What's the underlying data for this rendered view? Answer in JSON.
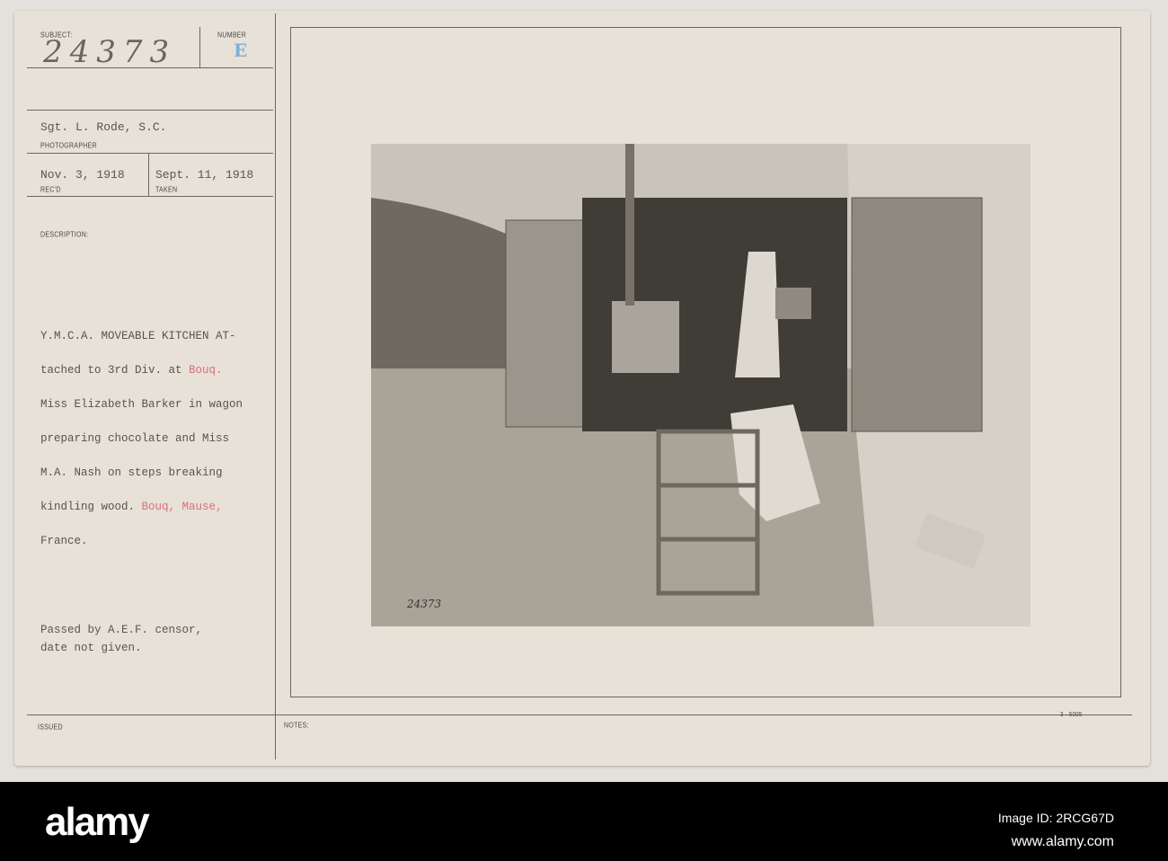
{
  "card": {
    "subject_label": "SUBJECT:",
    "subject_value": "24373",
    "number_label": "NUMBER",
    "number_value": "E",
    "photographer_name": "Sgt. L. Rode, S.C.",
    "photographer_label": "PHOTOGRAPHER",
    "received_date": "Nov. 3, 1918",
    "received_label": "REC'D",
    "taken_date": "Sept. 11, 1918",
    "taken_label": "TAKEN",
    "description_label": "DESCRIPTION:",
    "description_lines": [
      [
        "Y.M.C.A. MOVEABLE KITCHEN AT-",
        ""
      ],
      [
        "tached to 3rd Div. at ",
        "Bouq."
      ],
      [
        "Miss Elizabeth Barker in wagon",
        ""
      ],
      [
        "preparing chocolate and Miss",
        ""
      ],
      [
        "M.A. Nash on steps breaking",
        ""
      ],
      [
        "kindling wood. ",
        "Bouq, Mause,"
      ],
      [
        "France.",
        ""
      ]
    ],
    "censor_line1": "Passed by A.E.F. censor,",
    "censor_line2": "date not given.",
    "issued_label": "ISSUED",
    "notes_label": "NOTES:",
    "form_number": "3—5005",
    "photo_stamp_number": "24373"
  },
  "footer": {
    "logo": "alamy",
    "image_id": "Image ID: 2RCG67D",
    "url": "www.alamy.com"
  }
}
